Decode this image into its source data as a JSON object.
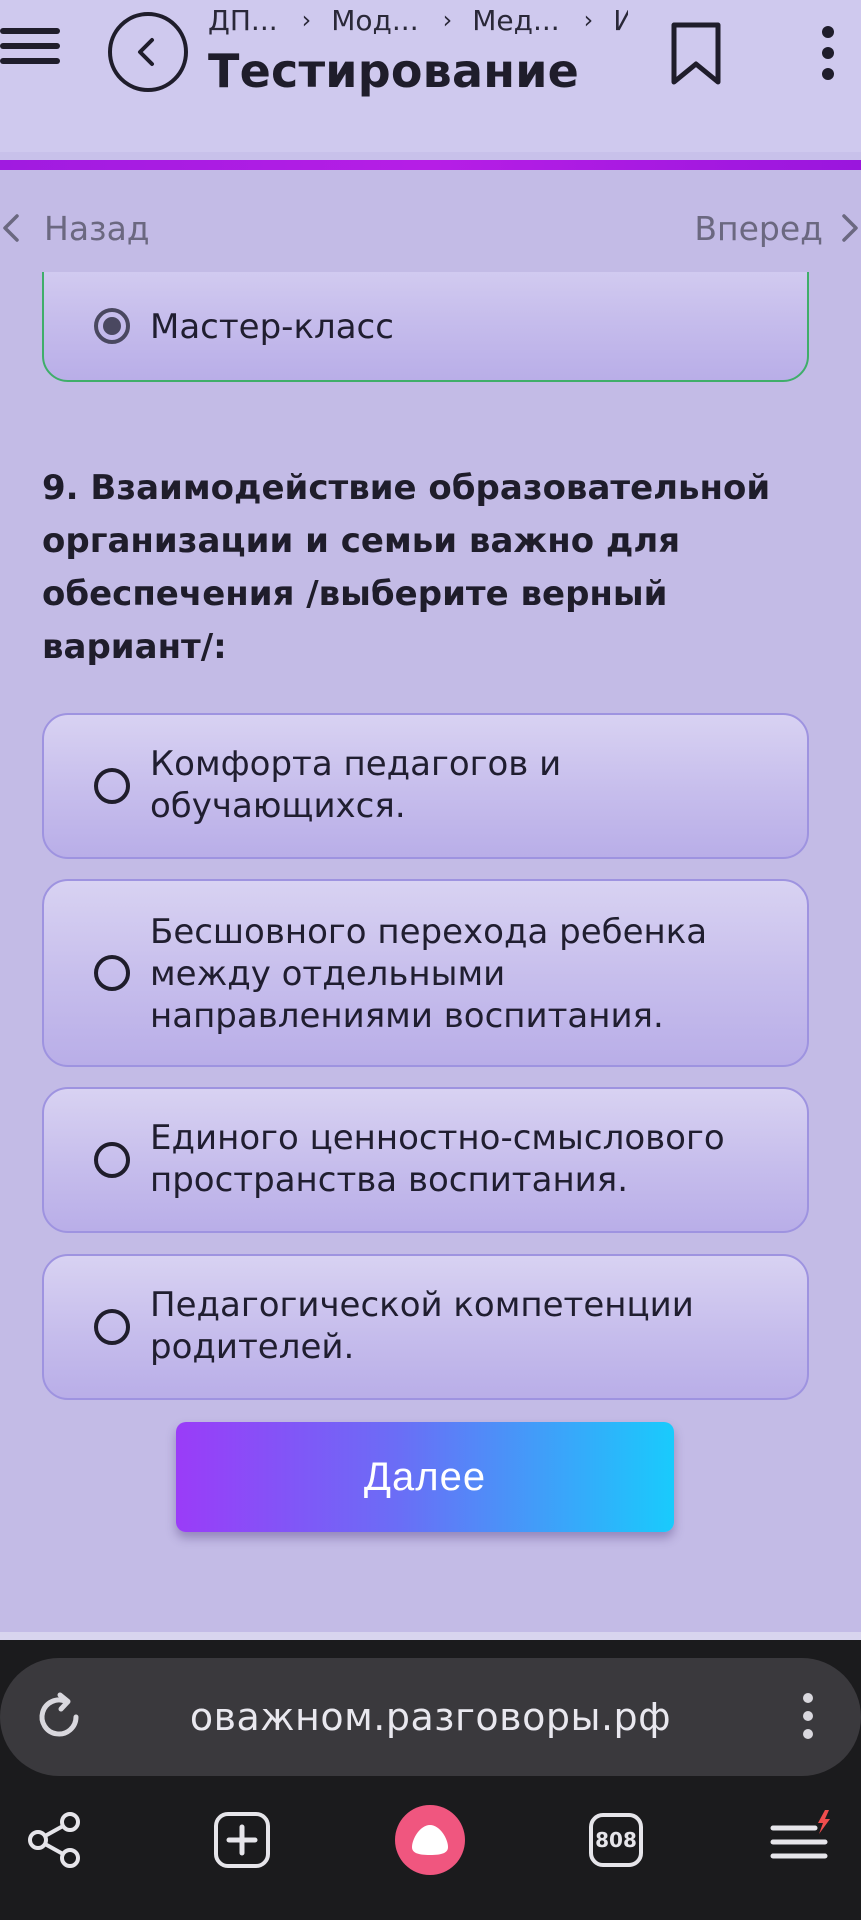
{
  "header": {
    "breadcrumbs": [
      "ДП...",
      "Мод...",
      "Мед...",
      "И"
    ],
    "title": "Тестирование"
  },
  "nav": {
    "prev_label": "Назад",
    "next_label": "Вперед"
  },
  "previous_answer": {
    "label": "Мастер-класс",
    "selected": true
  },
  "question": {
    "text": "9.  Взаимодействие образовательной организации и семьи важно для обеспечения /выберите верный вариант/:",
    "options": [
      {
        "label": "Комфорта педагогов и обучающихся.",
        "selected": false
      },
      {
        "label": "Бесшовного перехода ребенка между отдельными направлениями воспитания.",
        "selected": false
      },
      {
        "label": "Единого ценностно-смыслового пространства воспитания.",
        "selected": false
      },
      {
        "label": "Педагогической компетенции родителей.",
        "selected": false
      }
    ]
  },
  "next_button": {
    "label": "Далее"
  },
  "browser": {
    "url": "оважном.разговоры.рф",
    "tabs_count": "808"
  },
  "colors": {
    "progress": "#a01be0",
    "accent_alice": "#f0567f",
    "selected_border": "#3fae6a"
  }
}
